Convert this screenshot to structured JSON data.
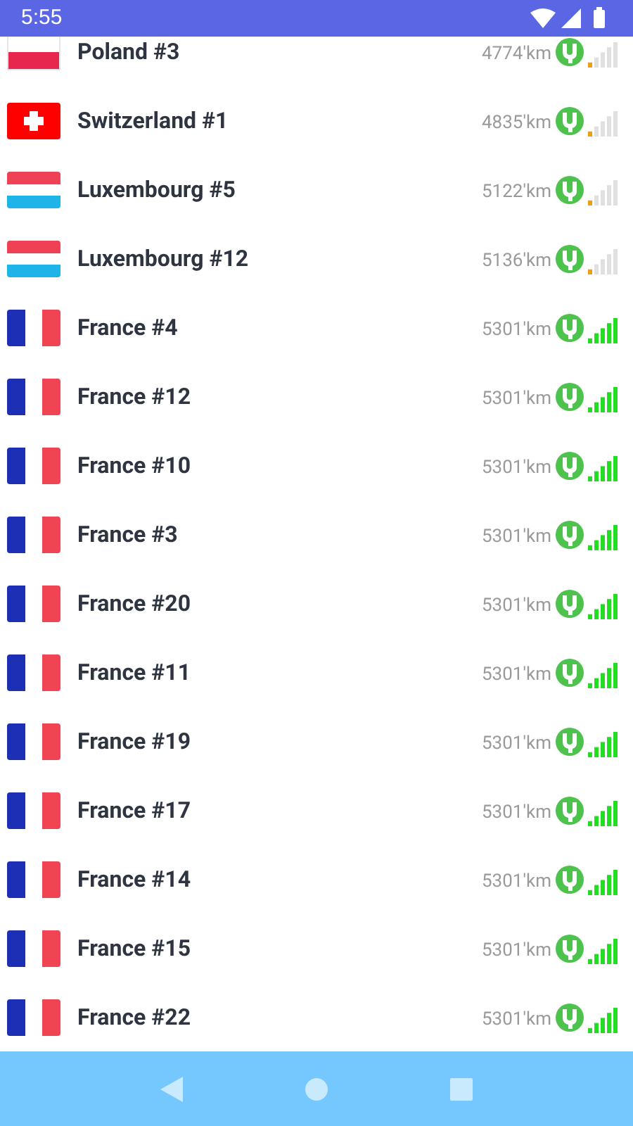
{
  "status_bar": {
    "time": "5:55"
  },
  "servers": [
    {
      "name": "Poland #3",
      "kind": "poland",
      "distance": "4774'km",
      "strong": false
    },
    {
      "name": "Switzerland #1",
      "kind": "switzerland",
      "distance": "4835'km",
      "strong": false
    },
    {
      "name": "Luxembourg #5",
      "kind": "luxembourg",
      "distance": "5122'km",
      "strong": false
    },
    {
      "name": "Luxembourg #12",
      "kind": "luxembourg",
      "distance": "5136'km",
      "strong": false
    },
    {
      "name": "France #4",
      "kind": "france",
      "distance": "5301'km",
      "strong": true
    },
    {
      "name": "France #12",
      "kind": "france",
      "distance": "5301'km",
      "strong": true
    },
    {
      "name": "France #10",
      "kind": "france",
      "distance": "5301'km",
      "strong": true
    },
    {
      "name": "France #3",
      "kind": "france",
      "distance": "5301'km",
      "strong": true
    },
    {
      "name": "France #20",
      "kind": "france",
      "distance": "5301'km",
      "strong": true
    },
    {
      "name": "France #11",
      "kind": "france",
      "distance": "5301'km",
      "strong": true
    },
    {
      "name": "France #19",
      "kind": "france",
      "distance": "5301'km",
      "strong": true
    },
    {
      "name": "France #17",
      "kind": "france",
      "distance": "5301'km",
      "strong": true
    },
    {
      "name": "France #14",
      "kind": "france",
      "distance": "5301'km",
      "strong": true
    },
    {
      "name": "France #15",
      "kind": "france",
      "distance": "5301'km",
      "strong": true
    },
    {
      "name": "France #22",
      "kind": "france",
      "distance": "5301'km",
      "strong": true
    }
  ]
}
